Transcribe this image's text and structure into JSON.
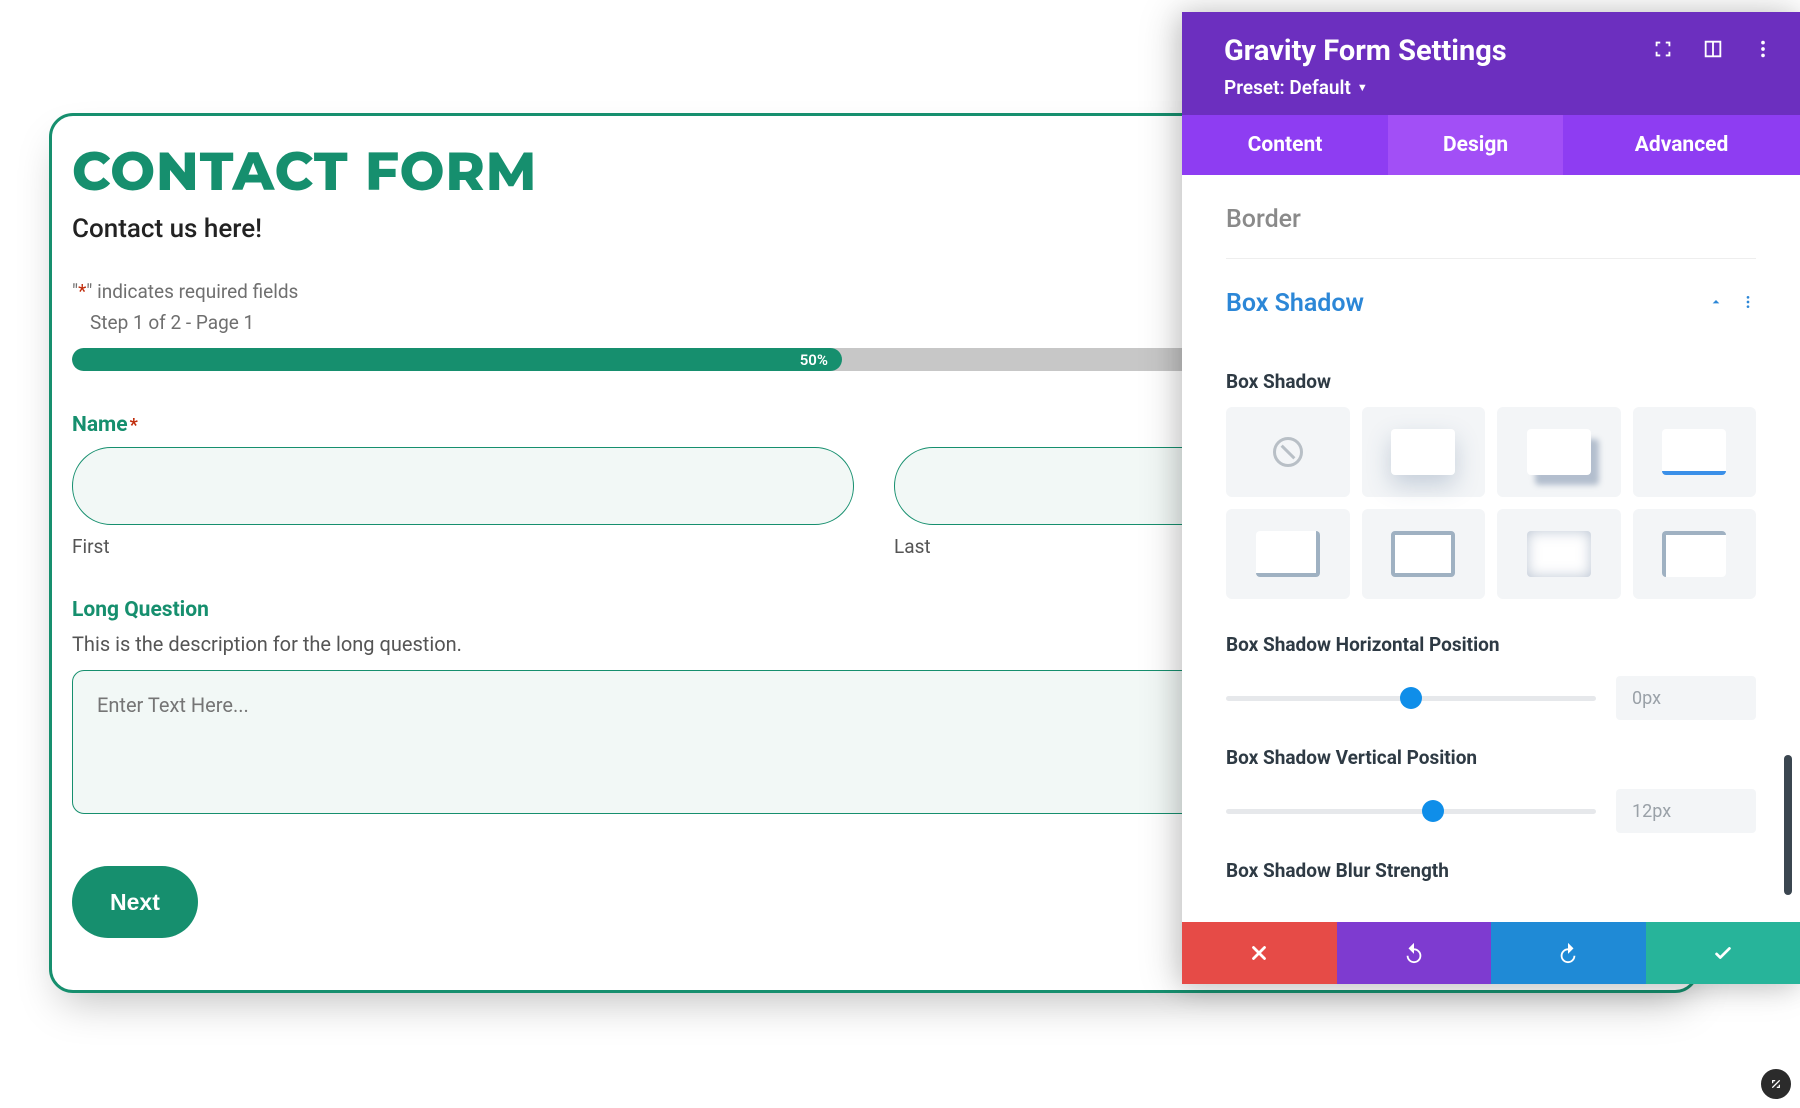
{
  "form": {
    "title": "CONTACT FORM",
    "subtitle": "Contact us here!",
    "required_prefix": "\"",
    "required_star": "*",
    "required_suffix": "\" indicates required fields",
    "step_label": "Step 1 of 2 - Page 1",
    "progress_pct": "50%",
    "progress_width": "48%",
    "name": {
      "label": "Name",
      "first_sub": "First",
      "last_sub": "Last"
    },
    "long_q": {
      "label": "Long Question",
      "desc": "This is the description for the long question.",
      "placeholder": "Enter Text Here..."
    },
    "next_label": "Next"
  },
  "panel": {
    "title": "Gravity Form Settings",
    "preset": "Preset: Default",
    "tabs": {
      "content": "Content",
      "design": "Design",
      "advanced": "Advanced"
    },
    "sections": {
      "border": "Border",
      "box_shadow": "Box Shadow"
    },
    "box_shadow_label": "Box Shadow",
    "sliders": {
      "horiz": {
        "label": "Box Shadow Horizontal Position",
        "value": "0px",
        "thumb_pct": "50%"
      },
      "vert": {
        "label": "Box Shadow Vertical Position",
        "value": "12px",
        "thumb_pct": "56%"
      },
      "blur": {
        "label": "Box Shadow Blur Strength"
      }
    }
  }
}
